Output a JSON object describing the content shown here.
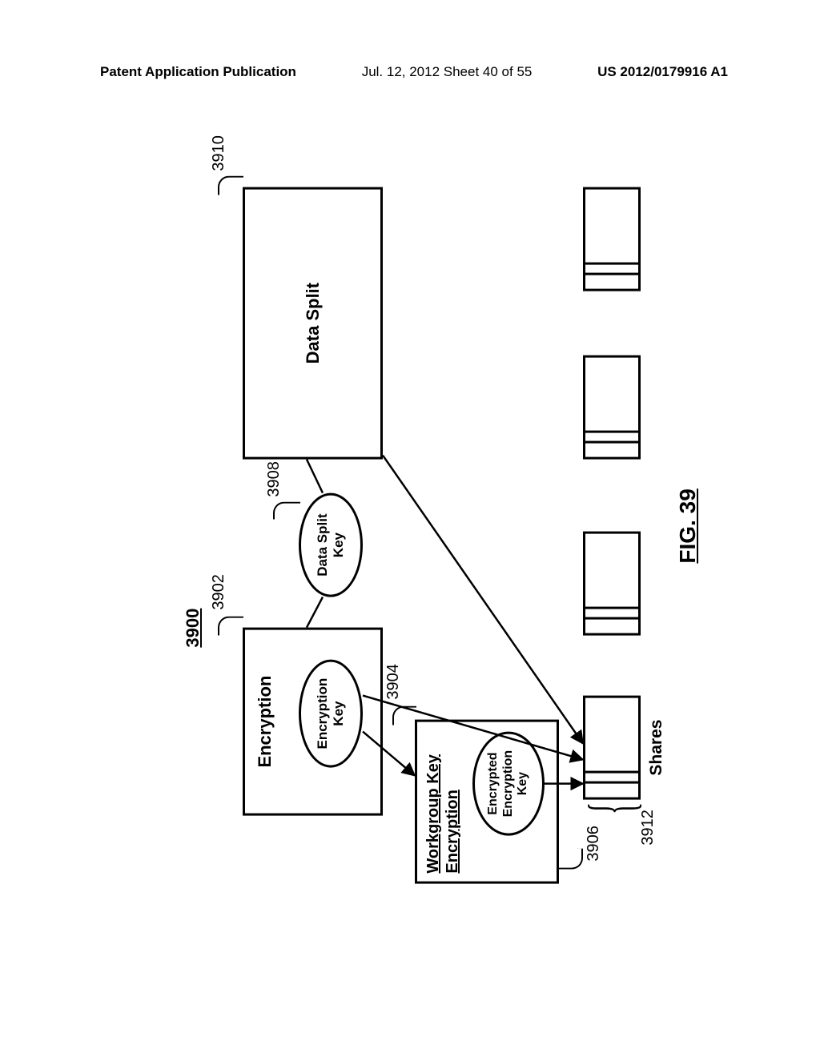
{
  "header": {
    "left": "Patent Application Publication",
    "mid": "Jul. 12, 2012  Sheet 40 of 55",
    "right": "US 2012/0179916 A1"
  },
  "fig": {
    "refnum": "3900",
    "caption": "FIG. 39"
  },
  "encryption": {
    "ref": "3902",
    "title": "Encryption",
    "key_label": "Encryption\nKey"
  },
  "workgroup": {
    "ref": "3904",
    "ref2": "3906",
    "title": "Workgroup Key\nEncryption",
    "key_label": "Encrypted\nEncryption\nKey"
  },
  "datasplit": {
    "ref": "3910",
    "ref_key": "3908",
    "title": "Data Split",
    "key_label": "Data Split\nKey"
  },
  "shares": {
    "ref": "3912",
    "label": "Shares"
  }
}
